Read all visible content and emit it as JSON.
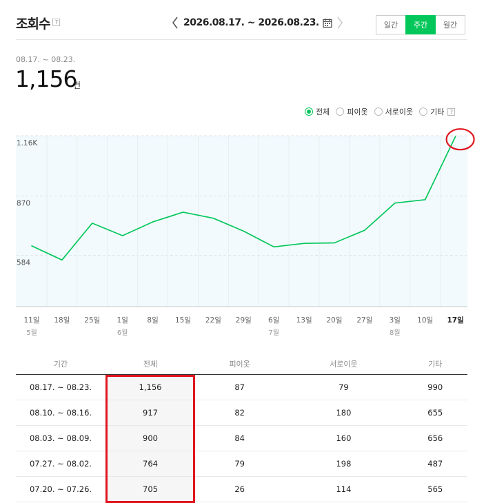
{
  "header": {
    "title": "조회수",
    "help": "?",
    "date_range": "2026.08.17. ~ 2026.08.23.",
    "period_tabs": [
      "일간",
      "주간",
      "월간"
    ],
    "active_tab": "주간"
  },
  "summary": {
    "range": "08.17. ~ 08.23.",
    "total": "1,156",
    "unit": "건"
  },
  "legend": {
    "options": [
      "전체",
      "피이옷",
      "서로이웃",
      "기타"
    ],
    "selected": "전체",
    "help": "?"
  },
  "colors": {
    "accent": "#03c75a",
    "highlight": "#e0141e",
    "plot_bg": "#f2fafd"
  },
  "chart_data": {
    "type": "line",
    "x": [
      "11일",
      "18일",
      "25일",
      "1일",
      "8일",
      "15일",
      "22일",
      "29일",
      "6일",
      "13일",
      "20일",
      "27일",
      "3일",
      "10일",
      "17일"
    ],
    "months": [
      "5월",
      "",
      "",
      "6월",
      "",
      "",
      "",
      "",
      "7월",
      "",
      "",
      "",
      "8월",
      "",
      ""
    ],
    "series": [
      {
        "values": [
          630,
          562,
          739,
          679,
          745,
          792,
          763,
          701,
          625,
          642,
          644,
          705,
          836,
          852,
          1156
        ]
      }
    ],
    "y_ticks": [
      {
        "label": "1.16K",
        "value": 1160
      },
      {
        "label": "870",
        "value": 870
      },
      {
        "label": "584",
        "value": 584
      }
    ],
    "ylim": [
      470,
      1160
    ],
    "grid": true,
    "highlight_last": true,
    "title": "",
    "xlabel": "",
    "ylabel": ""
  },
  "table": {
    "headers": [
      "기간",
      "전체",
      "피이옷",
      "서로이웃",
      "기타"
    ],
    "rows": [
      [
        "08.17. ~ 08.23.",
        "1,156",
        "87",
        "79",
        "990"
      ],
      [
        "08.10. ~ 08.16.",
        "917",
        "82",
        "180",
        "655"
      ],
      [
        "08.03. ~ 08.09.",
        "900",
        "84",
        "160",
        "656"
      ],
      [
        "07.27. ~ 08.02.",
        "764",
        "79",
        "198",
        "487"
      ],
      [
        "07.20. ~ 07.26.",
        "705",
        "26",
        "114",
        "565"
      ]
    ]
  }
}
